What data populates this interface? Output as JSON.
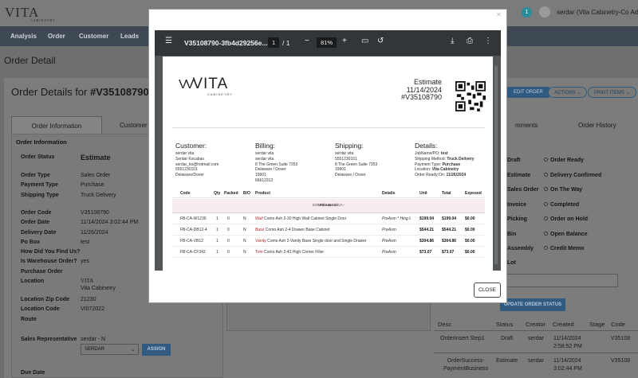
{
  "app": {
    "logo": "VITA",
    "logo_sub": "CABINETRY",
    "notif_count": "1",
    "user_name": "serdar (Vita Cabinetry-Co Admi"
  },
  "nav": [
    "Analysis",
    "Order",
    "Customer",
    "Leads"
  ],
  "page": {
    "header": "Order Detail",
    "title_prefix": "Order Details for",
    "order_id": "#V35108790",
    "tabs": [
      "Order Information",
      "Customer I",
      "mments",
      "Order History"
    ],
    "buttons": {
      "edit": "EDIT ORDER",
      "actions": "ACTIONS",
      "print": "PRINT ITEMS",
      "update_status": "UPDATE ORDER STATUS",
      "assign": "ASSIGN"
    }
  },
  "order_info": {
    "section": "Order Information",
    "rows": [
      {
        "label": "Order Status",
        "value": "Estimate"
      },
      {
        "label": "Order Type",
        "value": "Sales Order"
      },
      {
        "label": "Payment Type",
        "value": "Purchase"
      },
      {
        "label": "Shipping Type",
        "value": "Truck Delivery"
      },
      {
        "label": "Order Code",
        "value": "V35108790"
      },
      {
        "label": "Order Date",
        "value": "11/14/2024 3:02:44 PM"
      },
      {
        "label": "Delivery Date",
        "value": "11/26/2024"
      },
      {
        "label": "Po Box",
        "value": "test"
      },
      {
        "label": "How Did You Find Us?",
        "value": ""
      },
      {
        "label": "Is Warehouse Order?",
        "value": "yes"
      },
      {
        "label": "Purchase Order",
        "value": ""
      },
      {
        "label": "Location",
        "value": "Vita Cabinetry"
      },
      {
        "label": "Location Zip Code",
        "value": "21230"
      },
      {
        "label": "Location Code",
        "value": "VI072022"
      },
      {
        "label": "Route",
        "value": ""
      }
    ],
    "location_logo": "VITA",
    "sales_rep_label": "Sales Representative",
    "sales_rep_value": "serdar - N",
    "sales_rep_select": "SERDAR",
    "due_date_label": "Due Date"
  },
  "statuses": {
    "left": [
      "Draft",
      "Estimate",
      "Sales Order",
      "Invoice",
      "Picking",
      "Bin",
      "Assembly",
      "Lot"
    ],
    "right": [
      "Order Ready",
      "Delivery Confirmed",
      "On The Way",
      "Completed",
      "Order on Hold",
      "Open Balance",
      "Credit Memo"
    ]
  },
  "history": {
    "headers": [
      "Desc",
      "Status",
      "Creator",
      "Created",
      "Stage",
      "Code"
    ],
    "rows": [
      {
        "desc": "OrderInsert Step1",
        "status": "Draft",
        "creator": "serdar",
        "created": "11/14/2024 2:58:52 PM",
        "stage": "",
        "code": "V35108"
      },
      {
        "desc": "OrderSuccess-PaymentBusiness",
        "status": "Estimate",
        "creator": "serdar",
        "created": "11/14/2024 3:02:44 PM",
        "stage": "",
        "code": "V35108"
      }
    ]
  },
  "pdf": {
    "filename": "V35108790-3fb4d29256e...",
    "page_current": "1",
    "page_total": "/ 1",
    "zoom": "81%",
    "doc": {
      "logo": "VITA",
      "logo_sub": "CABINETRY",
      "doc_type": "Estimate",
      "date": "11/14/2024",
      "number": "#V35108790",
      "customer": {
        "title": "Customer:",
        "lines": [
          "serdar vita",
          "Serdar Kocabas",
          "serdar_ko@hotmail.com",
          "5551230101",
          "Delaware/Dover"
        ]
      },
      "billing": {
        "title": "Billing:",
        "lines": [
          "serdar vita",
          "serdar vita",
          "8 The Green Suite 7353",
          "Delaware / Dover",
          "19901",
          "66612312"
        ]
      },
      "shipping": {
        "title": "Shipping:",
        "lines": [
          "serdar vita",
          "5551230101",
          "8 The Green Suite 7353",
          "19901",
          "Delaware / Dover"
        ]
      },
      "details": {
        "title": "Details:",
        "lines": [
          {
            "k": "JobName/PO:",
            "v": "test"
          },
          {
            "k": "Shipping Method:",
            "v": "Truck Delivery"
          },
          {
            "k": "Payment Type:",
            "v": "Purchase"
          },
          {
            "k": "Location:",
            "v": "Vita Cabinetry"
          },
          {
            "k": "Order Ready On:",
            "v": "11/26/2024"
          }
        ]
      },
      "table_headers": [
        "Code",
        "Qty",
        "Packed",
        "B/O",
        "Product",
        "Details",
        "Unit",
        "Total",
        "Exposed"
      ],
      "group": {
        "line1": "COMO ASH 2 CA -",
        "line2": "Fabuwood"
      },
      "items": [
        {
          "code": "FB-CA-W1230",
          "qty": "1",
          "packed": "0",
          "bo": "N",
          "type": "Wall",
          "product": "Como Ash 2-30 High Wall Cabinet Single Door",
          "details": "PreAsm * Hing L",
          "unit": "$199.04",
          "total": "$199.04",
          "exposed": "$0.00"
        },
        {
          "code": "FB-CA-DB12-4",
          "qty": "1",
          "packed": "0",
          "bo": "N",
          "type": "Base",
          "product": "Como Ash 2-4 Drawer Base Cabinet",
          "details": "PreAsm",
          "unit": "$544.21",
          "total": "$544.21",
          "exposed": "$0.00"
        },
        {
          "code": "FB-CA-VB12",
          "qty": "1",
          "packed": "0",
          "bo": "N",
          "type": "Vanity",
          "product": "Como Ash 2-Vanity Base Single door and Single Drawer",
          "details": "PreAsm",
          "unit": "$304.86",
          "total": "$304.86",
          "exposed": "$0.00"
        },
        {
          "code": "FB-CA-CF342",
          "qty": "1",
          "packed": "0",
          "bo": "N",
          "type": "Trim",
          "product": "Como Ash 2-42 High Corner Filler",
          "details": "PreAsm",
          "unit": "$73.07",
          "total": "$73.07",
          "exposed": "$0.00"
        }
      ]
    },
    "close_label": "CLOSE"
  },
  "icons": [
    "menu-icon",
    "zoom-out-icon",
    "zoom-in-icon",
    "fit-page-icon",
    "rotate-icon",
    "download-icon",
    "print-icon",
    "more-icon",
    "close-icon",
    "user-icon"
  ]
}
